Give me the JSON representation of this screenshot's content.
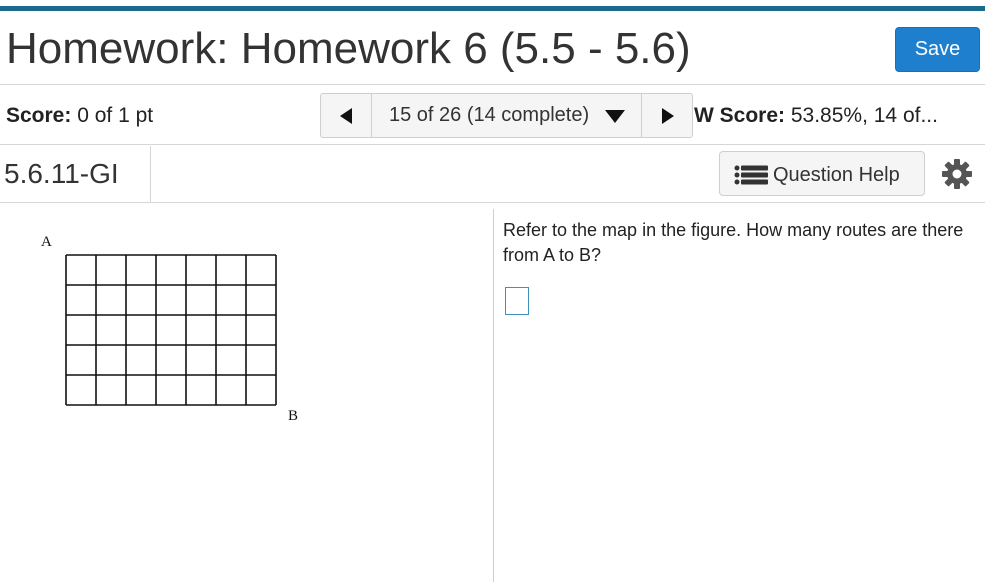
{
  "header": {
    "title": "Homework: Homework 6 (5.5 - 5.6)",
    "save_label": "Save"
  },
  "score_bar": {
    "score_label": "Score:",
    "score_value": "0 of 1 pt",
    "nav_position": "15 of 26 (14 complete)",
    "hw_score_label": "W Score:",
    "hw_score_value": "53.85%, 14 of..."
  },
  "question_bar": {
    "question_id": "5.6.11-GI",
    "help_label": "Question Help"
  },
  "figure": {
    "label_a": "A",
    "label_b": "B",
    "grid_columns": 7,
    "grid_rows": 5
  },
  "question": {
    "prompt": "Refer to the map in the figure. How many routes are there from A to B?",
    "answer_value": ""
  },
  "colors": {
    "accent_bar": "#1d6b8c",
    "save_button": "#1f7fcf",
    "input_border": "#3f8fbf"
  },
  "icons": {
    "prev": "triangle-left-icon",
    "next": "triangle-right-icon",
    "dropdown": "caret-down-icon",
    "help": "list-icon",
    "settings": "gear-icon"
  }
}
